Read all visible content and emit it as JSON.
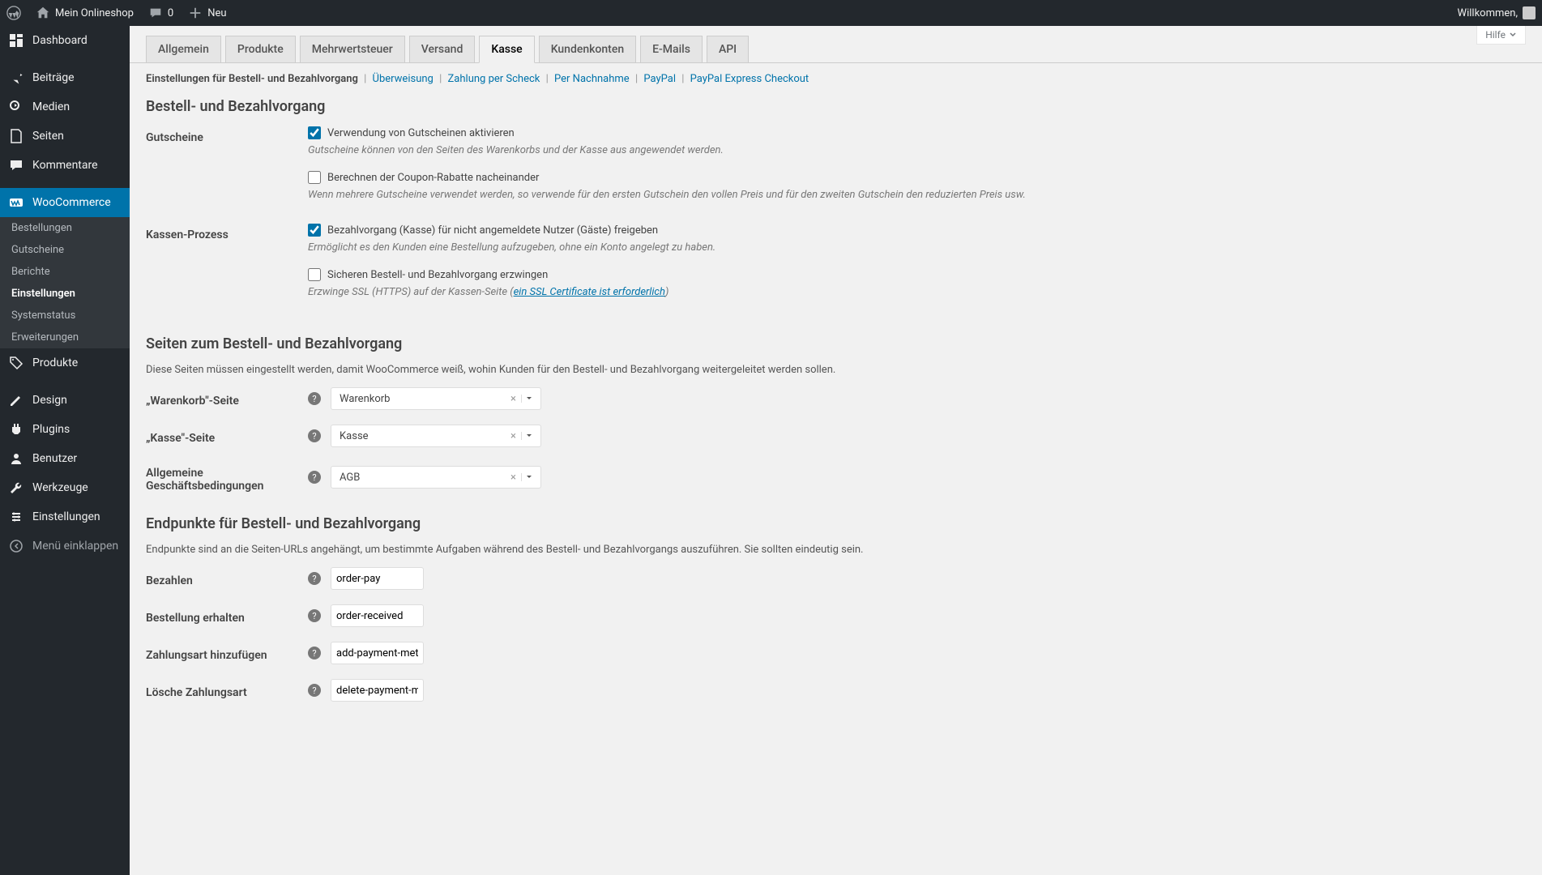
{
  "adminbar": {
    "site_name": "Mein Onlineshop",
    "comments_count": "0",
    "new_label": "Neu",
    "welcome": "Willkommen,"
  },
  "sidebar": {
    "items": {
      "dashboard": "Dashboard",
      "posts": "Beiträge",
      "media": "Medien",
      "pages": "Seiten",
      "comments": "Kommentare",
      "woocommerce": "WooCommerce",
      "products": "Produkte",
      "appearance": "Design",
      "plugins": "Plugins",
      "users": "Benutzer",
      "tools": "Werkzeuge",
      "settings": "Einstellungen",
      "collapse": "Menü einklappen"
    },
    "submenu": {
      "orders": "Bestellungen",
      "coupons": "Gutscheine",
      "reports": "Berichte",
      "settings": "Einstellungen",
      "status": "Systemstatus",
      "extensions": "Erweiterungen"
    }
  },
  "help_tab": "Hilfe",
  "tabs": {
    "general": "Allgemein",
    "products": "Produkte",
    "tax": "Mehrwertsteuer",
    "shipping": "Versand",
    "checkout": "Kasse",
    "accounts": "Kundenkonten",
    "emails": "E-Mails",
    "api": "API"
  },
  "sublinks": {
    "label": "Einstellungen für Bestell- und Bezahlvorgang",
    "bacs": "Überweisung",
    "cheque": "Zahlung per Scheck",
    "cod": "Per Nachnahme",
    "paypal": "PayPal",
    "paypal_express": "PayPal Express Checkout"
  },
  "section1": {
    "heading": "Bestell- und Bezahlvorgang",
    "coupons_label": "Gutscheine",
    "enable_coupons": "Verwendung von Gutscheinen aktivieren",
    "enable_coupons_desc": "Gutscheine können von den Seiten des Warenkorbs und der Kasse aus angewendet werden.",
    "calc_seq": "Berechnen der Coupon-Rabatte nacheinander",
    "calc_seq_desc": "Wenn mehrere Gutscheine verwendet werden, so verwende für den ersten Gutschein den vollen Preis und für den zweiten Gutschein den reduzierten Preis usw.",
    "checkout_process_label": "Kassen-Prozess",
    "guest_checkout": "Bezahlvorgang (Kasse) für nicht angemeldete Nutzer (Gäste) freigeben",
    "guest_checkout_desc": "Ermöglicht es den Kunden eine Bestellung aufzugeben, ohne ein Konto angelegt zu haben.",
    "force_ssl": "Sicheren Bestell- und Bezahlvorgang erzwingen",
    "force_ssl_desc_pre": "Erzwinge SSL (HTTPS) auf der Kassen-Seite (",
    "force_ssl_link": "ein SSL Certificate ist erforderlich",
    "force_ssl_desc_post": ")"
  },
  "section2": {
    "heading": "Seiten zum Bestell- und Bezahlvorgang",
    "desc": "Diese Seiten müssen eingestellt werden, damit WooCommerce weiß, wohin Kunden für den Bestell- und Bezahlvorgang weitergeleitet werden sollen.",
    "cart_label": "„Warenkorb\"-Seite",
    "cart_value": "Warenkorb",
    "checkout_label": "„Kasse\"-Seite",
    "checkout_value": "Kasse",
    "terms_label": "Allgemeine Geschäftsbedingungen",
    "terms_value": "AGB"
  },
  "section3": {
    "heading": "Endpunkte für Bestell- und Bezahlvorgang",
    "desc": "Endpunkte sind an die Seiten-URLs angehängt, um bestimmte Aufgaben während des Bestell- und Bezahlvorgangs auszuführen. Sie sollten eindeutig sein.",
    "pay_label": "Bezahlen",
    "pay_value": "order-pay",
    "received_label": "Bestellung erhalten",
    "received_value": "order-received",
    "add_payment_label": "Zahlungsart hinzufügen",
    "add_payment_value": "add-payment-method",
    "delete_payment_label": "Lösche Zahlungsart",
    "delete_payment_value": "delete-payment-method"
  }
}
